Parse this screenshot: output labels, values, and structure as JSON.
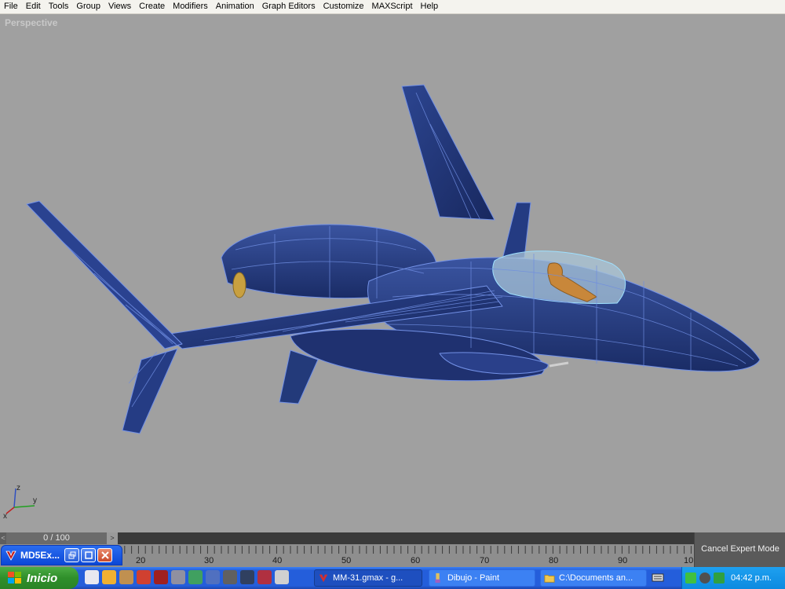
{
  "menu": [
    "File",
    "Edit",
    "Tools",
    "Group",
    "Views",
    "Create",
    "Modifiers",
    "Animation",
    "Graph Editors",
    "Customize",
    "MAXScript",
    "Help"
  ],
  "viewport": {
    "label": "Perspective",
    "axis": {
      "z": "z",
      "x": "x",
      "y": "y"
    }
  },
  "timeline": {
    "frame": "0 / 100",
    "left_arrow": "<",
    "right_arrow": ">",
    "ruler_labels": [
      "20",
      "30",
      "40",
      "50",
      "60",
      "70",
      "80",
      "90",
      "10"
    ]
  },
  "cancel_expert_mode": "Cancel Expert Mode",
  "minimized_window": {
    "title": "MD5Ex..."
  },
  "taskbar": {
    "start_label": "Inicio",
    "tasks": [
      "MM-31.gmax - g...",
      "Dibujo - Paint",
      "C:\\Documents an..."
    ],
    "clock": "04:42 p.m."
  },
  "colors": {
    "viewport_bg": "#a0a0a0",
    "model_fill": "#233a7a",
    "wire": "#6f8fe0",
    "taskbar": "#245edb",
    "start": "#2f8f2a"
  }
}
